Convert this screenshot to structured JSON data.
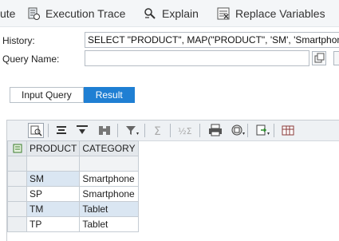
{
  "toolbar": {
    "items": [
      {
        "label": "ute",
        "icon": "execute-icon"
      },
      {
        "label": "Execution Trace",
        "icon": "execution-trace-icon"
      },
      {
        "label": "Explain",
        "icon": "explain-icon"
      },
      {
        "label": "Replace Variables",
        "icon": "replace-variables-icon"
      }
    ]
  },
  "form": {
    "history_label": "History:",
    "history_value": "SELECT \"PRODUCT\", MAP(\"PRODUCT\", 'SM', 'Smartphone",
    "query_name_label": "Query Name:",
    "query_name_value": ""
  },
  "tabs": [
    {
      "label": "Input Query",
      "active": false
    },
    {
      "label": "Result",
      "active": true
    }
  ],
  "grid": {
    "columns": [
      "PRODUCT",
      "CATEGORY"
    ],
    "rows": [
      [
        "SM",
        "Smartphone"
      ],
      [
        "SP",
        "Smartphone"
      ],
      [
        "TM",
        "Tablet"
      ],
      [
        "TP",
        "Tablet"
      ]
    ],
    "toolbar_icons": [
      "details-icon",
      "align-center-icon",
      "align-top-icon",
      "find-icon",
      "filter-icon",
      "sum-icon",
      "subtotal-icon",
      "print-icon",
      "views-icon",
      "export-icon",
      "layout-icon"
    ]
  },
  "colors": {
    "accent": "#1f7fd3",
    "alt_row": "#dae6f2"
  }
}
